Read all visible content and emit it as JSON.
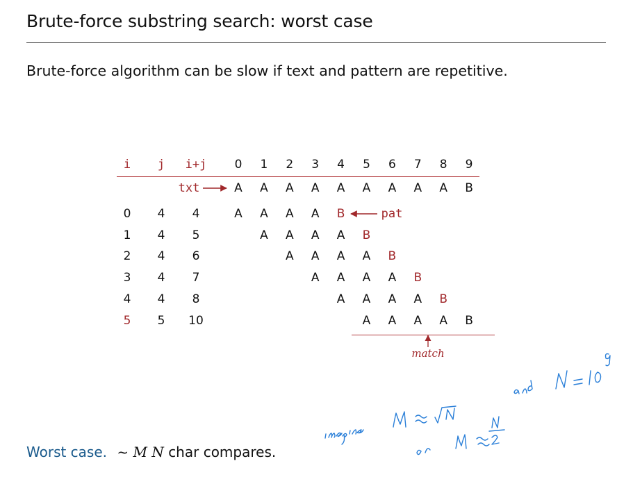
{
  "title": "Brute-force substring search:  worst case",
  "subtitle": "Brute-force algorithm can be slow if text and pattern are repetitive.",
  "table": {
    "headers": [
      "i",
      "j",
      "i+j"
    ],
    "index_labels": [
      "0",
      "1",
      "2",
      "3",
      "4",
      "5",
      "6",
      "7",
      "8",
      "9"
    ],
    "txt_label": "txt",
    "pat_label": "pat",
    "txt": [
      "A",
      "A",
      "A",
      "A",
      "A",
      "A",
      "A",
      "A",
      "A",
      "B"
    ],
    "rows": [
      {
        "i": "0",
        "j": "4",
        "ij": "4",
        "start": 0,
        "chars": [
          "A",
          "A",
          "A",
          "A",
          "B"
        ]
      },
      {
        "i": "1",
        "j": "4",
        "ij": "5",
        "start": 1,
        "chars": [
          "A",
          "A",
          "A",
          "A",
          "B"
        ]
      },
      {
        "i": "2",
        "j": "4",
        "ij": "6",
        "start": 2,
        "chars": [
          "A",
          "A",
          "A",
          "A",
          "B"
        ]
      },
      {
        "i": "3",
        "j": "4",
        "ij": "7",
        "start": 3,
        "chars": [
          "A",
          "A",
          "A",
          "A",
          "B"
        ]
      },
      {
        "i": "4",
        "j": "4",
        "ij": "8",
        "start": 4,
        "chars": [
          "A",
          "A",
          "A",
          "A",
          "B"
        ]
      },
      {
        "i": "5",
        "j": "5",
        "ij": "10",
        "start": 5,
        "chars": [
          "A",
          "A",
          "A",
          "A",
          "B"
        ]
      }
    ]
  },
  "match_label": "match",
  "worst_case": {
    "label": "Worst case.",
    "formula": "~ M N",
    "suffix": "char compares."
  },
  "annotations": {
    "handwriting_text": "imagine  M ≈ √N  and  N = 10^9  or  M ≈ N/2",
    "ink_color": "#2a7fd8"
  },
  "colors": {
    "accent": "#a1282b",
    "worst_label": "#1a5a8c"
  }
}
